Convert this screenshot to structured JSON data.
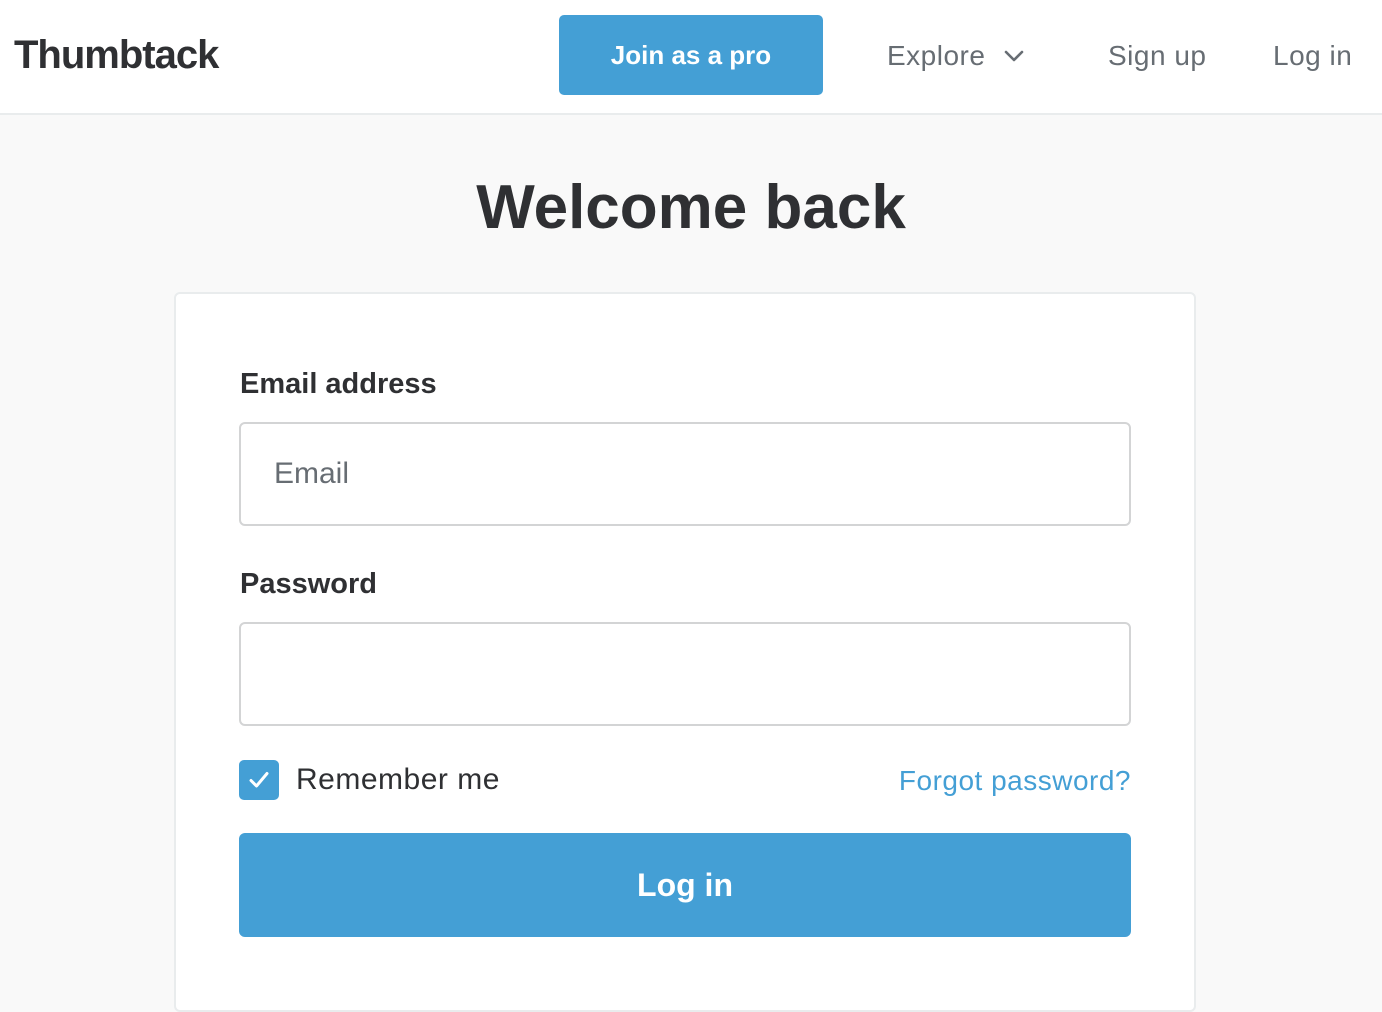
{
  "header": {
    "logo_text": "Thumbtack",
    "join_label": "Join as a pro",
    "explore_label": "Explore",
    "explore_icon": "chevron-down-icon",
    "signup_label": "Sign up",
    "login_label": "Log in"
  },
  "main": {
    "title": "Welcome back",
    "email": {
      "label": "Email address",
      "placeholder": "Email",
      "value": ""
    },
    "password": {
      "label": "Password",
      "value": ""
    },
    "remember_me": {
      "label": "Remember me",
      "checked": true,
      "icon": "check-icon"
    },
    "forgot_label": "Forgot password?",
    "submit_label": "Log in"
  },
  "colors": {
    "accent": "#449fd5",
    "text": "#2f3033",
    "muted": "#676d73",
    "background": "#f9f9f9"
  }
}
